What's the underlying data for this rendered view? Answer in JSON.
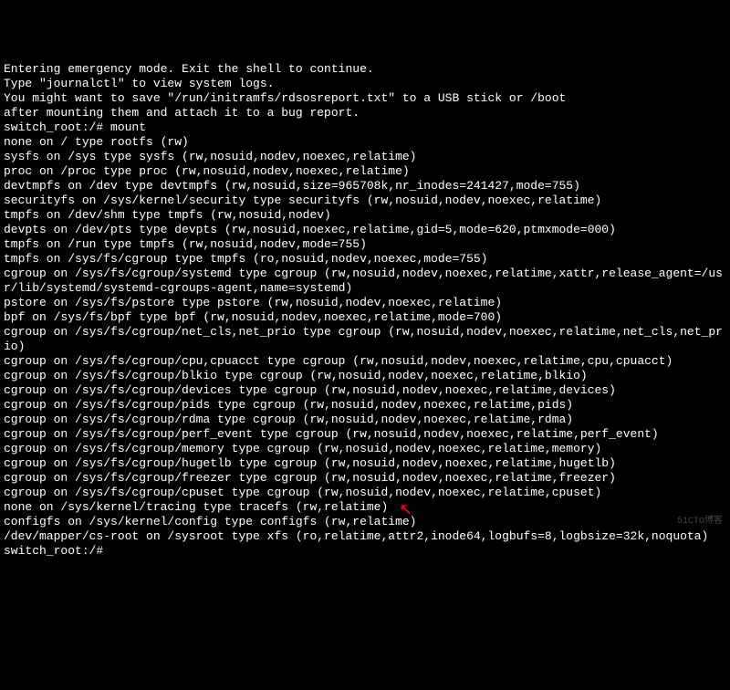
{
  "lines": [
    "Entering emergency mode. Exit the shell to continue.",
    "Type \"journalctl\" to view system logs.",
    "You might want to save \"/run/initramfs/rdsosreport.txt\" to a USB stick or /boot",
    "after mounting them and attach it to a bug report.",
    "",
    "",
    "switch_root:/# mount",
    "none on / type rootfs (rw)",
    "sysfs on /sys type sysfs (rw,nosuid,nodev,noexec,relatime)",
    "proc on /proc type proc (rw,nosuid,nodev,noexec,relatime)",
    "devtmpfs on /dev type devtmpfs (rw,nosuid,size=965708k,nr_inodes=241427,mode=755)",
    "securityfs on /sys/kernel/security type securityfs (rw,nosuid,nodev,noexec,relatime)",
    "tmpfs on /dev/shm type tmpfs (rw,nosuid,nodev)",
    "devpts on /dev/pts type devpts (rw,nosuid,noexec,relatime,gid=5,mode=620,ptmxmode=000)",
    "tmpfs on /run type tmpfs (rw,nosuid,nodev,mode=755)",
    "tmpfs on /sys/fs/cgroup type tmpfs (ro,nosuid,nodev,noexec,mode=755)",
    "cgroup on /sys/fs/cgroup/systemd type cgroup (rw,nosuid,nodev,noexec,relatime,xattr,release_agent=/usr/lib/systemd/systemd-cgroups-agent,name=systemd)",
    "pstore on /sys/fs/pstore type pstore (rw,nosuid,nodev,noexec,relatime)",
    "bpf on /sys/fs/bpf type bpf (rw,nosuid,nodev,noexec,relatime,mode=700)",
    "cgroup on /sys/fs/cgroup/net_cls,net_prio type cgroup (rw,nosuid,nodev,noexec,relatime,net_cls,net_prio)",
    "cgroup on /sys/fs/cgroup/cpu,cpuacct type cgroup (rw,nosuid,nodev,noexec,relatime,cpu,cpuacct)",
    "cgroup on /sys/fs/cgroup/blkio type cgroup (rw,nosuid,nodev,noexec,relatime,blkio)",
    "cgroup on /sys/fs/cgroup/devices type cgroup (rw,nosuid,nodev,noexec,relatime,devices)",
    "cgroup on /sys/fs/cgroup/pids type cgroup (rw,nosuid,nodev,noexec,relatime,pids)",
    "cgroup on /sys/fs/cgroup/rdma type cgroup (rw,nosuid,nodev,noexec,relatime,rdma)",
    "cgroup on /sys/fs/cgroup/perf_event type cgroup (rw,nosuid,nodev,noexec,relatime,perf_event)",
    "cgroup on /sys/fs/cgroup/memory type cgroup (rw,nosuid,nodev,noexec,relatime,memory)",
    "cgroup on /sys/fs/cgroup/hugetlb type cgroup (rw,nosuid,nodev,noexec,relatime,hugetlb)",
    "cgroup on /sys/fs/cgroup/freezer type cgroup (rw,nosuid,nodev,noexec,relatime,freezer)",
    "cgroup on /sys/fs/cgroup/cpuset type cgroup (rw,nosuid,nodev,noexec,relatime,cpuset)",
    "none on /sys/kernel/tracing type tracefs (rw,relatime)",
    "configfs on /sys/kernel/config type configfs (rw,relatime)",
    "/dev/mapper/cs-root on /sysroot type xfs (ro,relatime,attr2,inode64,logbufs=8,logbsize=32k,noquota)",
    "switch_root:/# "
  ],
  "watermark": "51CTO博客",
  "pointer_glyph": "↖"
}
